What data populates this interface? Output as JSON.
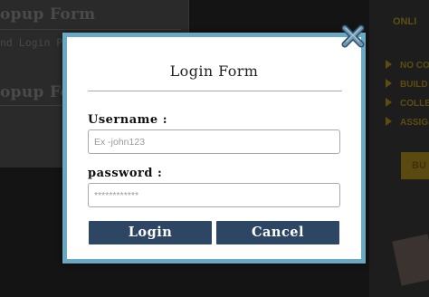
{
  "background": {
    "card_title": "opup Form",
    "card_text": "nd Login Popup form Will",
    "card_title2": "opup Form",
    "sidebar_heading": "ONLI",
    "sidebar_items": [
      "NO CO",
      "BUILD",
      "COLLE",
      "ASSIG"
    ],
    "sidebar_button": "BU"
  },
  "modal": {
    "title": "Login Form",
    "username_label": "Username :",
    "username_placeholder": "Ex -john123",
    "username_value": "",
    "password_label": "password :",
    "password_placeholder": "************",
    "password_value": "",
    "login_label": "Login",
    "cancel_label": "Cancel",
    "close_icon": "close-x-icon"
  },
  "colors": {
    "modal_border": "#6aa9c4",
    "button_bg": "#2c4663",
    "close_icon": "#4f7893"
  }
}
